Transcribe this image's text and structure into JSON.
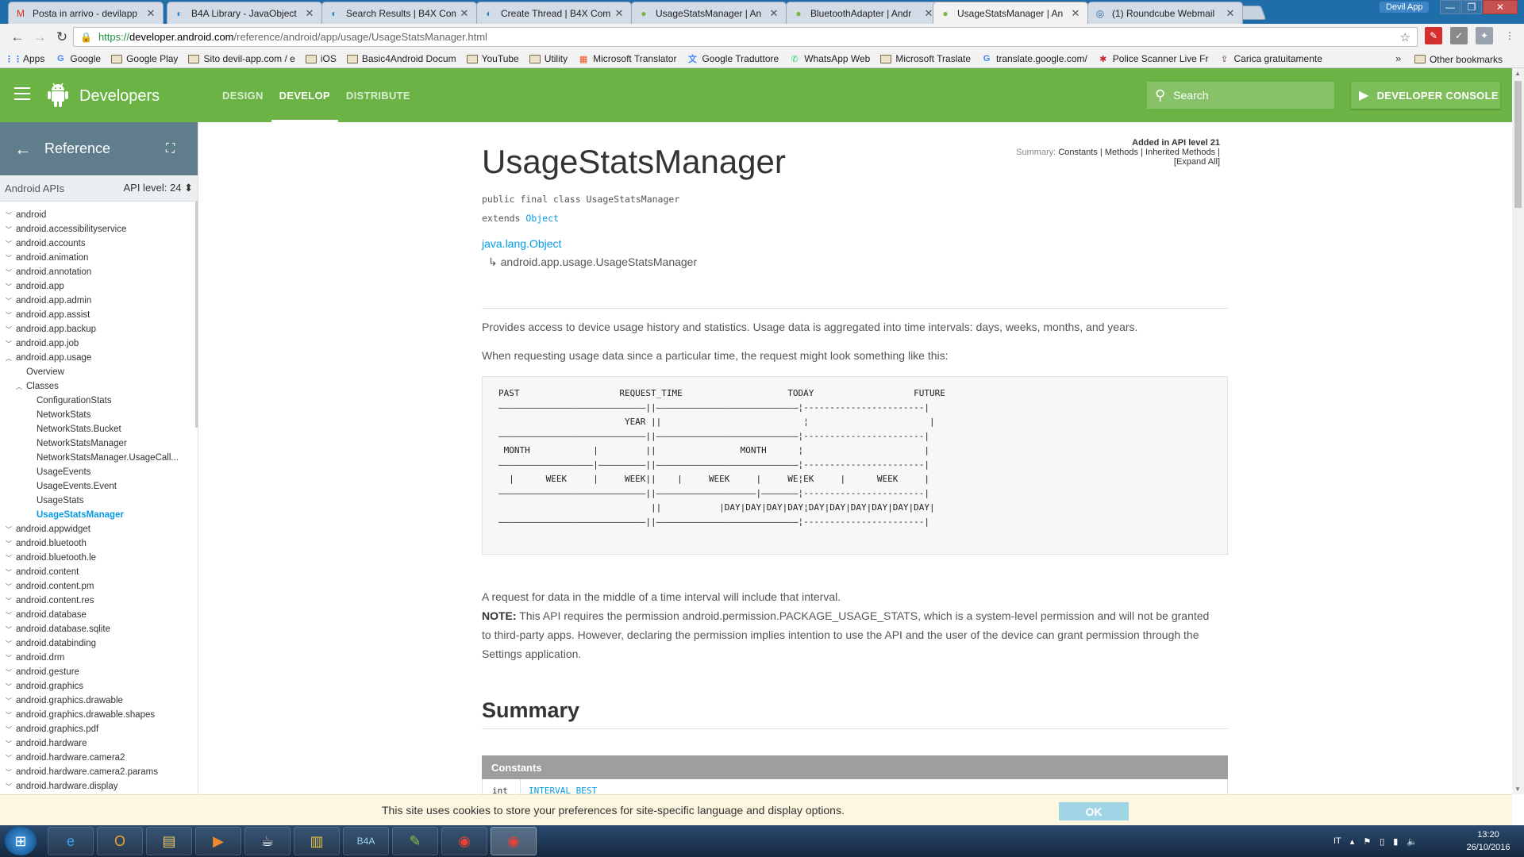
{
  "browser": {
    "tabs": [
      {
        "title": "Posta in arrivo - devilapp",
        "icon": "gmail-icon",
        "glyph": "M",
        "color": "#d93025"
      },
      {
        "title": "B4A Library - JavaObject",
        "icon": "b4x-icon",
        "glyph": "◐",
        "color": "#1a8ad4"
      },
      {
        "title": "Search Results | B4X Com",
        "icon": "b4x-icon",
        "glyph": "◐",
        "color": "#1a8ad4"
      },
      {
        "title": "Create Thread | B4X Com",
        "icon": "b4x-icon",
        "glyph": "◐",
        "color": "#1a8ad4"
      },
      {
        "title": "UsageStatsManager | An",
        "icon": "android-icon",
        "glyph": "●",
        "color": "#7cb342"
      },
      {
        "title": "BluetoothAdapter | Andr",
        "icon": "android-icon",
        "glyph": "●",
        "color": "#7cb342"
      },
      {
        "title": "UsageStatsManager | An",
        "icon": "android-icon",
        "glyph": "●",
        "color": "#7cb342"
      },
      {
        "title": "(1) Roundcube Webmail",
        "icon": "roundcube-icon",
        "glyph": "◎",
        "color": "#2b65a0"
      }
    ],
    "active_tab": 6,
    "user": "Devil App",
    "url": {
      "scheme": "https://",
      "host": "developer.android.com",
      "path": "/reference/android/app/usage/UsageStatsManager.html"
    },
    "bookmarks": [
      {
        "label": "Apps",
        "icon": "apps-grid-icon"
      },
      {
        "label": "Google",
        "icon": "google-icon"
      },
      {
        "label": "Google Play",
        "icon": "folder-icon"
      },
      {
        "label": "Sito devil-app.com / e",
        "icon": "folder-icon"
      },
      {
        "label": "iOS",
        "icon": "folder-icon"
      },
      {
        "label": "Basic4Android Docum",
        "icon": "folder-icon"
      },
      {
        "label": "YouTube",
        "icon": "folder-icon"
      },
      {
        "label": "Utility",
        "icon": "folder-icon"
      },
      {
        "label": "Microsoft Translator",
        "icon": "microsoft-icon"
      },
      {
        "label": "Google Traduttore",
        "icon": "translate-icon"
      },
      {
        "label": "WhatsApp Web",
        "icon": "whatsapp-icon"
      },
      {
        "label": "Microsoft Traslate",
        "icon": "folder-icon"
      },
      {
        "label": "translate.google.com/",
        "icon": "google-icon"
      },
      {
        "label": "Police Scanner Live Fr",
        "icon": "police-icon"
      },
      {
        "label": "Carica gratuitamente",
        "icon": "upload-icon"
      }
    ],
    "other_bookmarks": "Other bookmarks"
  },
  "site": {
    "brand": "Developers",
    "nav": [
      "DESIGN",
      "DEVELOP",
      "DISTRIBUTE"
    ],
    "active_nav": 1,
    "search_placeholder": "Search",
    "console_label": "DEVELOPER CONSOLE"
  },
  "sidebar": {
    "title": "Reference",
    "apis_label": "Android APIs",
    "api_level_label": "API level: 24",
    "items": [
      {
        "label": "android",
        "level": 1,
        "state": "collapsed"
      },
      {
        "label": "android.accessibilityservice",
        "level": 1,
        "state": "collapsed"
      },
      {
        "label": "android.accounts",
        "level": 1,
        "state": "collapsed"
      },
      {
        "label": "android.animation",
        "level": 1,
        "state": "collapsed"
      },
      {
        "label": "android.annotation",
        "level": 1,
        "state": "collapsed"
      },
      {
        "label": "android.app",
        "level": 1,
        "state": "collapsed"
      },
      {
        "label": "android.app.admin",
        "level": 1,
        "state": "collapsed"
      },
      {
        "label": "android.app.assist",
        "level": 1,
        "state": "collapsed"
      },
      {
        "label": "android.app.backup",
        "level": 1,
        "state": "collapsed"
      },
      {
        "label": "android.app.job",
        "level": 1,
        "state": "collapsed"
      },
      {
        "label": "android.app.usage",
        "level": 1,
        "state": "expanded"
      },
      {
        "label": "Overview",
        "level": 2,
        "state": "leaf"
      },
      {
        "label": "Classes",
        "level": 2,
        "state": "expanded"
      },
      {
        "label": "ConfigurationStats",
        "level": 3,
        "state": "leaf"
      },
      {
        "label": "NetworkStats",
        "level": 3,
        "state": "leaf"
      },
      {
        "label": "NetworkStats.Bucket",
        "level": 3,
        "state": "leaf"
      },
      {
        "label": "NetworkStatsManager",
        "level": 3,
        "state": "leaf"
      },
      {
        "label": "NetworkStatsManager.UsageCall...",
        "level": 3,
        "state": "leaf"
      },
      {
        "label": "UsageEvents",
        "level": 3,
        "state": "leaf"
      },
      {
        "label": "UsageEvents.Event",
        "level": 3,
        "state": "leaf"
      },
      {
        "label": "UsageStats",
        "level": 3,
        "state": "leaf"
      },
      {
        "label": "UsageStatsManager",
        "level": 3,
        "state": "selected"
      },
      {
        "label": "android.appwidget",
        "level": 1,
        "state": "collapsed"
      },
      {
        "label": "android.bluetooth",
        "level": 1,
        "state": "collapsed"
      },
      {
        "label": "android.bluetooth.le",
        "level": 1,
        "state": "collapsed"
      },
      {
        "label": "android.content",
        "level": 1,
        "state": "collapsed"
      },
      {
        "label": "android.content.pm",
        "level": 1,
        "state": "collapsed"
      },
      {
        "label": "android.content.res",
        "level": 1,
        "state": "collapsed"
      },
      {
        "label": "android.database",
        "level": 1,
        "state": "collapsed"
      },
      {
        "label": "android.database.sqlite",
        "level": 1,
        "state": "collapsed"
      },
      {
        "label": "android.databinding",
        "level": 1,
        "state": "collapsed"
      },
      {
        "label": "android.drm",
        "level": 1,
        "state": "collapsed"
      },
      {
        "label": "android.gesture",
        "level": 1,
        "state": "collapsed"
      },
      {
        "label": "android.graphics",
        "level": 1,
        "state": "collapsed"
      },
      {
        "label": "android.graphics.drawable",
        "level": 1,
        "state": "collapsed"
      },
      {
        "label": "android.graphics.drawable.shapes",
        "level": 1,
        "state": "collapsed"
      },
      {
        "label": "android.graphics.pdf",
        "level": 1,
        "state": "collapsed"
      },
      {
        "label": "android.hardware",
        "level": 1,
        "state": "collapsed"
      },
      {
        "label": "android.hardware.camera2",
        "level": 1,
        "state": "collapsed"
      },
      {
        "label": "android.hardware.camera2.params",
        "level": 1,
        "state": "collapsed"
      },
      {
        "label": "android.hardware.display",
        "level": 1,
        "state": "collapsed"
      }
    ]
  },
  "doc": {
    "added": "Added in API level 21",
    "summary_prefix": "Summary:",
    "summary_links": [
      "Constants",
      "Methods",
      "Inherited Methods"
    ],
    "expand_all": "[Expand All]",
    "title": "UsageStatsManager",
    "signature_line1": "public final class UsageStatsManager",
    "extends_kw": "extends",
    "extends_class": "Object",
    "hierarchy_parent": "java.lang.Object",
    "hierarchy_child": "↳ android.app.usage.UsageStatsManager",
    "para1": "Provides access to device usage history and statistics. Usage data is aggregated into time intervals: days, weeks, months, and years.",
    "para2": "When requesting usage data since a particular time, the request might look something like this:",
    "diagram": "PAST                   REQUEST_TIME                    TODAY                   FUTURE\n————————————————————————————||———————————————————————————¦-----------------------|\n                        YEAR ||                           ¦                       |\n————————————————————————————||———————————————————————————¦-----------------------|\n MONTH            |         ||                MONTH      ¦                       |\n——————————————————|—————————||———————————————————————————¦-----------------------|\n  |      WEEK     |     WEEK||    |     WEEK     |     WE¦EK     |      WEEK     |\n————————————————————————————||———————————————————|———————¦-----------------------|\n                             ||           |DAY|DAY|DAY|DAY¦DAY|DAY|DAY|DAY|DAY|DAY|\n————————————————————————————||———————————————————————————¦-----------------------|",
    "para3": "A request for data in the middle of a time interval will include that interval.",
    "note_label": "NOTE:",
    "note_text": " This API requires the permission android.permission.PACKAGE_USAGE_STATS, which is a system-level permission and will not be granted to third-party apps. However, declaring the permission implies intention to use the API and the user of the device can grant permission through the Settings application.",
    "summary_heading": "Summary",
    "constants_heading": "Constants",
    "const_type": "int",
    "const_name": "INTERVAL_BEST"
  },
  "cookie": {
    "message": "This site uses cookies to store your preferences for site-specific language and display options.",
    "ok": "OK"
  },
  "taskbar": {
    "apps": [
      {
        "name": "ie-icon",
        "glyph": "e",
        "color": "#3aa0e8"
      },
      {
        "name": "outlook-icon",
        "glyph": "O",
        "color": "#f0a030"
      },
      {
        "name": "explorer-icon",
        "glyph": "▤",
        "color": "#e8c66a"
      },
      {
        "name": "media-player-icon",
        "glyph": "▶",
        "color": "#f08a30"
      },
      {
        "name": "java-icon",
        "glyph": "☕",
        "color": "#f2f2f2"
      },
      {
        "name": "archive-icon",
        "glyph": "▥",
        "color": "#e0c040"
      },
      {
        "name": "b4a-icon",
        "glyph": "B4A",
        "color": "#9fd3ef"
      },
      {
        "name": "notepad-icon",
        "glyph": "✎",
        "color": "#8bc34a"
      },
      {
        "name": "chrome-icon",
        "glyph": "◉",
        "color": "#e94235"
      },
      {
        "name": "chrome-icon",
        "glyph": "◉",
        "color": "#e94235"
      }
    ],
    "active_app": 9,
    "language": "IT",
    "time": "13:20",
    "date": "26/10/2016"
  }
}
